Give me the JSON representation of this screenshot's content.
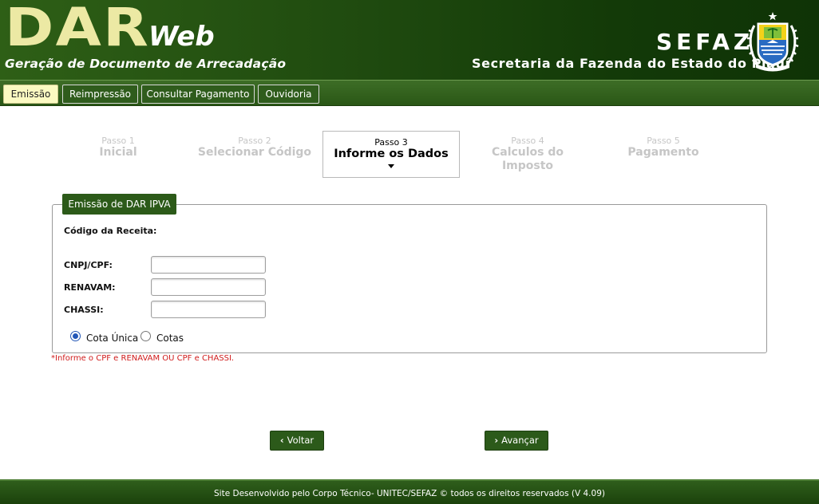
{
  "header": {
    "logo_main": "DAR",
    "logo_web": "Web",
    "subtitle": "Geração de Documento de Arrecadação",
    "org_acronym": "SEFAZ",
    "org_name": "Secretaria da Fazenda do Estado do Piauí",
    "emblem_icon": "state-coat-of-arms-icon"
  },
  "nav": {
    "items": [
      {
        "label": "Emissão",
        "active": true
      },
      {
        "label": "Reimpressão",
        "active": false
      },
      {
        "label": "Consultar Pagamento",
        "active": false
      },
      {
        "label": "Ouvidoria",
        "active": false
      }
    ]
  },
  "steps": [
    {
      "num": "Passo 1",
      "name": "Inicial",
      "state": "inactive"
    },
    {
      "num": "Passo 2",
      "name": "Selecionar Código",
      "state": "inactive"
    },
    {
      "num": "Passo 3",
      "name": "Informe os Dados",
      "state": "active"
    },
    {
      "num": "Passo 4",
      "name_line1": "Calculos do",
      "name_line2": "Imposto",
      "state": "inactive"
    },
    {
      "num": "Passo 5",
      "name": "Pagamento",
      "state": "inactive"
    }
  ],
  "form": {
    "legend": "Emissão de DAR IPVA",
    "codigo_label": "Código da Receita:",
    "fields": [
      {
        "label": "CNPJ/CPF:",
        "value": "",
        "placeholder": ""
      },
      {
        "label": "RENAVAM:",
        "value": "",
        "placeholder": ""
      },
      {
        "label": "CHASSI:",
        "value": "",
        "placeholder": ""
      }
    ],
    "radios": [
      {
        "label": "Cota Única",
        "checked": true
      },
      {
        "label": "Cotas",
        "checked": false
      }
    ],
    "hint": "*Informe o CPF e RENAVAM OU CPF e CHASSI."
  },
  "actions": {
    "back_label": "Voltar",
    "next_label": "Avançar"
  },
  "footer": {
    "text": "Site Desenvolvido pelo Corpo Técnico- UNITEC/SEFAZ © todos os direitos reservados (V 4.09)"
  },
  "colors": {
    "header_green": "#1f4a0f",
    "logo_yellow": "#ece9a4",
    "active_tab": "#fbfac2",
    "button_green": "#2c5a1a",
    "hint_red": "#d01c1c"
  }
}
